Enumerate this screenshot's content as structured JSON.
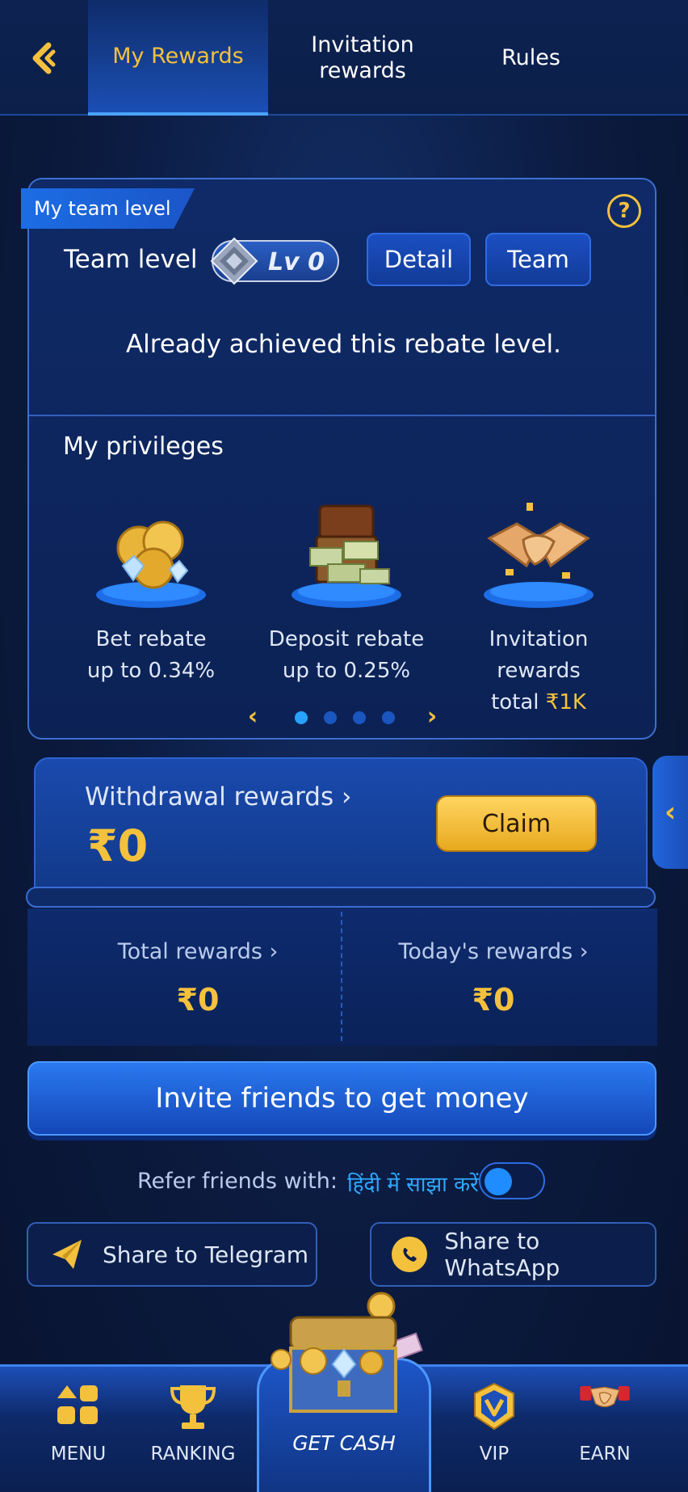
{
  "header": {
    "tabs": [
      {
        "label": "My Rewards",
        "active": true
      },
      {
        "label": "Invitation rewards",
        "active": false
      },
      {
        "label": "Rules",
        "active": false
      }
    ]
  },
  "team": {
    "ribbon": "My team level",
    "level_label": "Team level",
    "level_badge": "Lv 0",
    "detail_label": "Detail",
    "team_label": "Team",
    "achieved_text": "Already achieved this rebate level.",
    "help_icon": "?"
  },
  "privileges": {
    "title": "My privileges",
    "items": [
      {
        "line1": "Bet rebate",
        "line2": "up to 0.34%",
        "icon": "coins-diamonds-icon"
      },
      {
        "line1": "Deposit rebate",
        "line2": "up to 0.25%",
        "icon": "money-chest-icon"
      },
      {
        "line1": "Invitation rewards",
        "line2_prefix": "total ",
        "line2_value": "₹1K",
        "icon": "handshake-icon"
      }
    ],
    "carousel": {
      "pages": 4,
      "current": 1
    }
  },
  "withdrawal": {
    "label": "Withdrawal rewards ›",
    "amount": "₹0",
    "claim_label": "Claim",
    "side_tab": "‹"
  },
  "rewards": {
    "total_label": "Total rewards ›",
    "total_value": "₹0",
    "today_label": "Today's rewards ›",
    "today_value": "₹0"
  },
  "invite": {
    "button_label": "Invite friends to get money",
    "refer_label": "Refer friends with:",
    "refer_language": "हिंदी में साझा करें",
    "toggle_on": false
  },
  "share": {
    "telegram_label": "Share to Telegram",
    "whatsapp_label": "Share to WhatsApp"
  },
  "nav": {
    "menu": "MENU",
    "ranking": "RANKING",
    "get_cash": "GET CASH",
    "vip": "VIP",
    "earn": "EARN"
  },
  "colors": {
    "accent_gold": "#f4c13d",
    "primary_blue": "#1b4fc2",
    "background": "#0b1a3e"
  }
}
